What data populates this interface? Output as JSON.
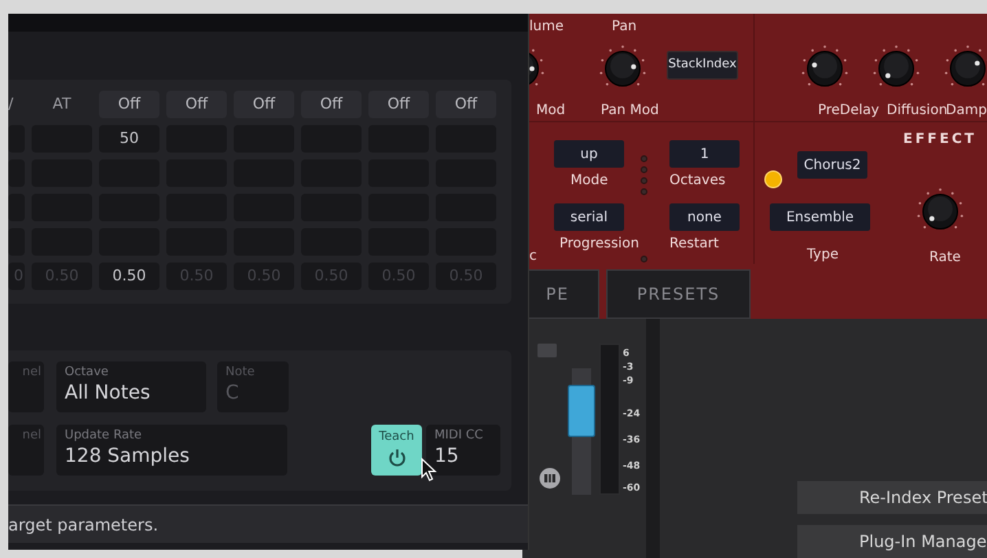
{
  "matrix": {
    "header": [
      {
        "kind": "label",
        "text": "/"
      },
      {
        "kind": "label",
        "text": "AT"
      },
      {
        "kind": "button",
        "text": "Off"
      },
      {
        "kind": "button",
        "text": "Off"
      },
      {
        "kind": "button",
        "text": "Off"
      },
      {
        "kind": "button",
        "text": "Off"
      },
      {
        "kind": "button",
        "text": "Off"
      },
      {
        "kind": "button",
        "text": "Off"
      }
    ],
    "rows": [
      {
        "cells": [
          {},
          {},
          {
            "value": "50",
            "dim": false
          },
          {},
          {},
          {},
          {},
          {}
        ]
      },
      {
        "cells": [
          {},
          {},
          {},
          {},
          {},
          {},
          {},
          {}
        ]
      },
      {
        "cells": [
          {},
          {},
          {},
          {},
          {},
          {},
          {},
          {}
        ]
      },
      {
        "cells": [
          {},
          {},
          {},
          {},
          {},
          {},
          {},
          {}
        ]
      },
      {
        "cells": [
          {
            "value": "0",
            "dim": true
          },
          {
            "value": "0.50",
            "dim": true
          },
          {
            "value": "0.50",
            "dim": false
          },
          {
            "value": "0.50",
            "dim": true
          },
          {
            "value": "0.50",
            "dim": true
          },
          {
            "value": "0.50",
            "dim": true
          },
          {
            "value": "0.50",
            "dim": true
          },
          {
            "value": "0.50",
            "dim": true
          }
        ]
      }
    ]
  },
  "settings": [
    [
      {
        "label": "nel",
        "disabled": true
      },
      {
        "label": "Octave",
        "value": "All Notes",
        "disabled": false
      },
      {
        "label": "Note",
        "value": "C",
        "disabled": true
      }
    ],
    [
      {
        "label": "nel",
        "disabled": true
      },
      {
        "label": "Update Rate",
        "value": "128 Samples",
        "disabled": false
      },
      {
        "kind": "teach",
        "label": "Teach",
        "on": true
      },
      {
        "label": "MIDI CC",
        "value": "15",
        "disabled": false
      }
    ]
  ],
  "status": "arget parameters.",
  "synth": {
    "top_labels": [
      "lume",
      "Pan"
    ],
    "knobs": [
      {
        "label": "Mod"
      },
      {
        "label": "Pan Mod"
      },
      {
        "label": "PreDelay"
      },
      {
        "label": "Diffusion"
      },
      {
        "label": "Damp"
      },
      {
        "label": "Rate"
      }
    ],
    "stack_button": "StackIndex",
    "section_title": "EFFECT",
    "arp": [
      {
        "value": "up",
        "label": "Mode"
      },
      {
        "value": "1",
        "label": "Octaves"
      },
      {
        "value": "serial",
        "label": "Progression"
      },
      {
        "value": "none",
        "label": "Restart"
      }
    ],
    "partial_label": "c",
    "effect": {
      "on": true,
      "preset": "Chorus2",
      "type_value": "Ensemble",
      "type_label": "Type"
    },
    "tabs": [
      {
        "label": "PE",
        "selected": false
      },
      {
        "label": "PRESETS",
        "selected": false
      }
    ]
  },
  "mixer": {
    "fader": {
      "level": 0.78
    },
    "scale": [
      "6",
      "-3",
      "-9",
      "-24",
      "-36",
      "-48",
      "-60"
    ]
  },
  "buttons": [
    "Re-Index Preset",
    "Plug-In Manage"
  ]
}
